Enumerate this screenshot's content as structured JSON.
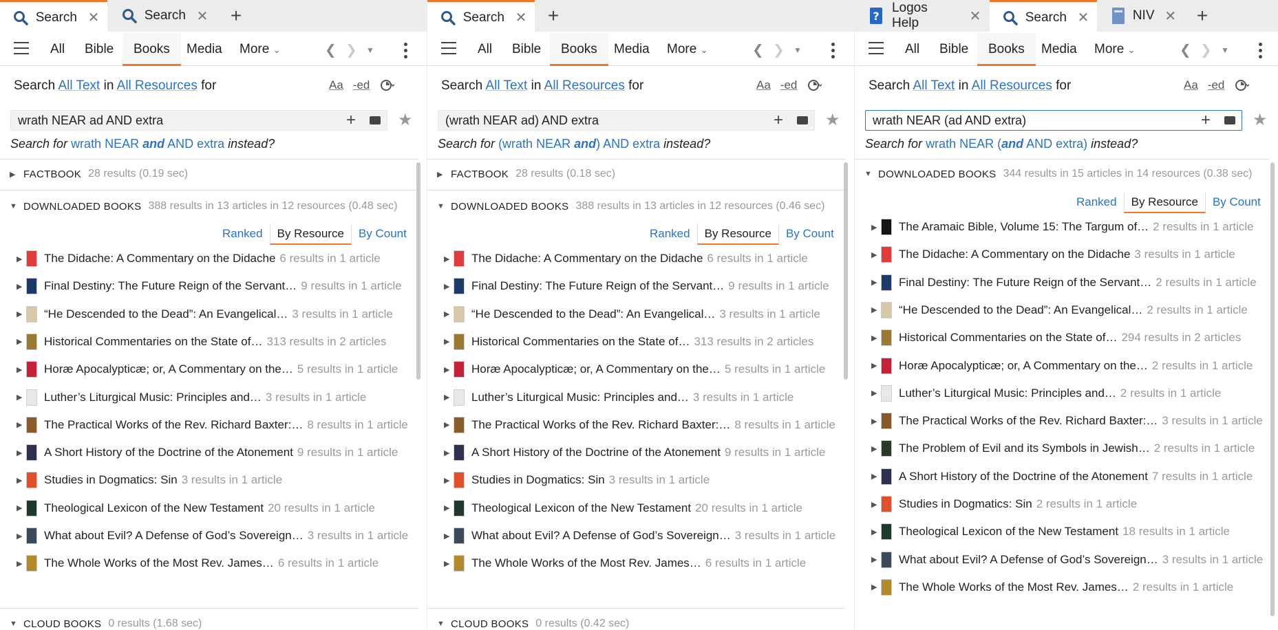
{
  "panes": [
    {
      "tabs": [
        {
          "icon": "search-icon",
          "label": "Search",
          "close": "✕",
          "active": true
        },
        {
          "icon": "search-icon",
          "label": "Search",
          "close": "✕",
          "active": false
        }
      ],
      "nav": {
        "items": [
          "All",
          "Bible",
          "Books",
          "Media",
          "More"
        ],
        "active": "Books"
      },
      "search_line": {
        "prefix": "Search",
        "text_scope": "All Text",
        "in": "in",
        "resource_scope": "All Resources",
        "suffix": "for"
      },
      "options": {
        "case": "Aa",
        "stem": "-ed"
      },
      "query": "wrath NEAR ad AND extra",
      "suggestion": {
        "prefix": "Search for",
        "parts": [
          {
            "t": "wrath NEAR ",
            "b": false
          },
          {
            "t": "and",
            "b": true
          },
          {
            "t": " AND extra",
            "b": false
          }
        ],
        "suffix": "instead?"
      },
      "sections": [
        {
          "label": "FACTBOOK",
          "stat": "28 results (0.19 sec)",
          "expanded": false
        },
        {
          "label": "DOWNLOADED BOOKS",
          "stat": "388 results in 13 articles in 12 resources (0.48 sec)",
          "expanded": true
        },
        {
          "label": "CLOUD BOOKS",
          "stat": "0 results (1.68 sec)",
          "expanded": true
        }
      ],
      "sort_tabs": [
        "Ranked",
        "By Resource",
        "By Count"
      ],
      "sort_active": "By Resource",
      "results": [
        {
          "title": "The Didache: A Commentary on the Didache",
          "count": "6 results in 1 article",
          "color": "#e23b3b"
        },
        {
          "title": "Final Destiny: The Future Reign of the Servant…",
          "count": "9 results in 1 article",
          "color": "#1c3b6b"
        },
        {
          "title": "“He Descended to the Dead”: An Evangelical…",
          "count": "3 results in 1 article",
          "color": "#d8c8a8"
        },
        {
          "title": "Historical Commentaries on the State of…",
          "count": "313 results in 2 articles",
          "color": "#9a7a32"
        },
        {
          "title": "Horæ Apocalypticæ; or, A Commentary on the…",
          "count": "5 results in 1 article",
          "color": "#c6223a"
        },
        {
          "title": "Luther’s Liturgical Music: Principles and…",
          "count": "3 results in 1 article",
          "color": "#e8e8e8"
        },
        {
          "title": "The Practical Works of the Rev. Richard Baxter:…",
          "count": "8 results in 1 article",
          "color": "#8a5a2a"
        },
        {
          "title": "A Short History of the Doctrine of the Atonement",
          "count": "9 results in 1 article",
          "color": "#2e3050"
        },
        {
          "title": "Studies in Dogmatics: Sin",
          "count": "3 results in 1 article",
          "color": "#e0502a"
        },
        {
          "title": "Theological Lexicon of the New Testament",
          "count": "20 results in 1 article",
          "color": "#1e3a2a"
        },
        {
          "title": "What about Evil? A Defense of God’s Sovereign…",
          "count": "3 results in 1 article",
          "color": "#3a4a5a"
        },
        {
          "title": "The Whole Works of the Most Rev. James…",
          "count": "6 results in 1 article",
          "color": "#b28a2a"
        }
      ]
    },
    {
      "tabs": [
        {
          "icon": "search-icon",
          "label": "Search",
          "close": "✕",
          "active": true
        }
      ],
      "nav": {
        "items": [
          "All",
          "Bible",
          "Books",
          "Media",
          "More"
        ],
        "active": "Books"
      },
      "search_line": {
        "prefix": "Search",
        "text_scope": "All Text",
        "in": "in",
        "resource_scope": "All Resources",
        "suffix": "for"
      },
      "options": {
        "case": "Aa",
        "stem": "-ed"
      },
      "query": "(wrath NEAR ad) AND extra",
      "suggestion": {
        "prefix": "Search for",
        "parts": [
          {
            "t": "(wrath NEAR ",
            "b": false
          },
          {
            "t": "and",
            "b": true
          },
          {
            "t": ") AND extra",
            "b": false
          }
        ],
        "suffix": "instead?"
      },
      "sections": [
        {
          "label": "FACTBOOK",
          "stat": "28 results (0.18 sec)",
          "expanded": false
        },
        {
          "label": "DOWNLOADED BOOKS",
          "stat": "388 results in 13 articles in 12 resources (0.46 sec)",
          "expanded": true
        },
        {
          "label": "CLOUD BOOKS",
          "stat": "0 results (0.42 sec)",
          "expanded": true
        }
      ],
      "sort_tabs": [
        "Ranked",
        "By Resource",
        "By Count"
      ],
      "sort_active": "By Resource",
      "results": [
        {
          "title": "The Didache: A Commentary on the Didache",
          "count": "6 results in 1 article",
          "color": "#e23b3b"
        },
        {
          "title": "Final Destiny: The Future Reign of the Servant…",
          "count": "9 results in 1 article",
          "color": "#1c3b6b"
        },
        {
          "title": "“He Descended to the Dead”: An Evangelical…",
          "count": "3 results in 1 article",
          "color": "#d8c8a8"
        },
        {
          "title": "Historical Commentaries on the State of…",
          "count": "313 results in 2 articles",
          "color": "#9a7a32"
        },
        {
          "title": "Horæ Apocalypticæ; or, A Commentary on the…",
          "count": "5 results in 1 article",
          "color": "#c6223a"
        },
        {
          "title": "Luther’s Liturgical Music: Principles and…",
          "count": "3 results in 1 article",
          "color": "#e8e8e8"
        },
        {
          "title": "The Practical Works of the Rev. Richard Baxter:…",
          "count": "8 results in 1 article",
          "color": "#8a5a2a"
        },
        {
          "title": "A Short History of the Doctrine of the Atonement",
          "count": "9 results in 1 article",
          "color": "#2e3050"
        },
        {
          "title": "Studies in Dogmatics: Sin",
          "count": "3 results in 1 article",
          "color": "#e0502a"
        },
        {
          "title": "Theological Lexicon of the New Testament",
          "count": "20 results in 1 article",
          "color": "#1e3a2a"
        },
        {
          "title": "What about Evil? A Defense of God’s Sovereign…",
          "count": "3 results in 1 article",
          "color": "#3a4a5a"
        },
        {
          "title": "The Whole Works of the Most Rev. James…",
          "count": "6 results in 1 article",
          "color": "#b28a2a"
        }
      ]
    },
    {
      "tabs": [
        {
          "icon": "help-icon",
          "label": "Logos Help",
          "close": "✕",
          "active": false
        },
        {
          "icon": "search-icon",
          "label": "Search",
          "close": "✕",
          "active": true
        },
        {
          "icon": "bible-icon",
          "label": "NIV",
          "close": "✕",
          "active": false
        }
      ],
      "nav": {
        "items": [
          "All",
          "Bible",
          "Books",
          "Media",
          "More"
        ],
        "active": "Books"
      },
      "search_line": {
        "prefix": "Search",
        "text_scope": "All Text",
        "in": "in",
        "resource_scope": "All Resources",
        "suffix": "for"
      },
      "options": {
        "case": "Aa",
        "stem": "-ed"
      },
      "query": "wrath NEAR (ad AND extra)",
      "suggestion": {
        "prefix": "Search for",
        "parts": [
          {
            "t": "wrath NEAR (",
            "b": false
          },
          {
            "t": "and",
            "b": true
          },
          {
            "t": " AND extra)",
            "b": false
          }
        ],
        "suffix": "instead?"
      },
      "sections": [
        {
          "label": "DOWNLOADED BOOKS",
          "stat": "344 results in 15 articles in 14 resources (0.38 sec)",
          "expanded": true
        }
      ],
      "sort_tabs": [
        "Ranked",
        "By Resource",
        "By Count"
      ],
      "sort_active": "By Resource",
      "results": [
        {
          "title": "The Aramaic Bible, Volume 15: The Targum of…",
          "count": "2 results in 1 article",
          "color": "#151515"
        },
        {
          "title": "The Didache: A Commentary on the Didache",
          "count": "3 results in 1 article",
          "color": "#e23b3b"
        },
        {
          "title": "Final Destiny: The Future Reign of the Servant…",
          "count": "2 results in 1 article",
          "color": "#1c3b6b"
        },
        {
          "title": "“He Descended to the Dead”: An Evangelical…",
          "count": "2 results in 1 article",
          "color": "#d8c8a8"
        },
        {
          "title": "Historical Commentaries on the State of…",
          "count": "294 results in 2 articles",
          "color": "#9a7a32"
        },
        {
          "title": "Horæ Apocalypticæ; or, A Commentary on the…",
          "count": "2 results in 1 article",
          "color": "#c6223a"
        },
        {
          "title": "Luther’s Liturgical Music: Principles and…",
          "count": "2 results in 1 article",
          "color": "#e8e8e8"
        },
        {
          "title": "The Practical Works of the Rev. Richard Baxter:…",
          "count": "3 results in 1 article",
          "color": "#8a5a2a"
        },
        {
          "title": "The Problem of Evil and its Symbols in Jewish…",
          "count": "2 results in 1 article",
          "color": "#2a3a2a"
        },
        {
          "title": "A Short History of the Doctrine of the Atonement",
          "count": "7 results in 1 article",
          "color": "#2e3050"
        },
        {
          "title": "Studies in Dogmatics: Sin",
          "count": "2 results in 1 article",
          "color": "#e0502a"
        },
        {
          "title": "Theological Lexicon of the New Testament",
          "count": "18 results in 1 article",
          "color": "#1e3a2a"
        },
        {
          "title": "What about Evil? A Defense of God’s Sovereign…",
          "count": "3 results in 1 article",
          "color": "#3a4a5a"
        },
        {
          "title": "The Whole Works of the Most Rev. James…",
          "count": "2 results in 1 article",
          "color": "#b28a2a"
        }
      ]
    }
  ]
}
